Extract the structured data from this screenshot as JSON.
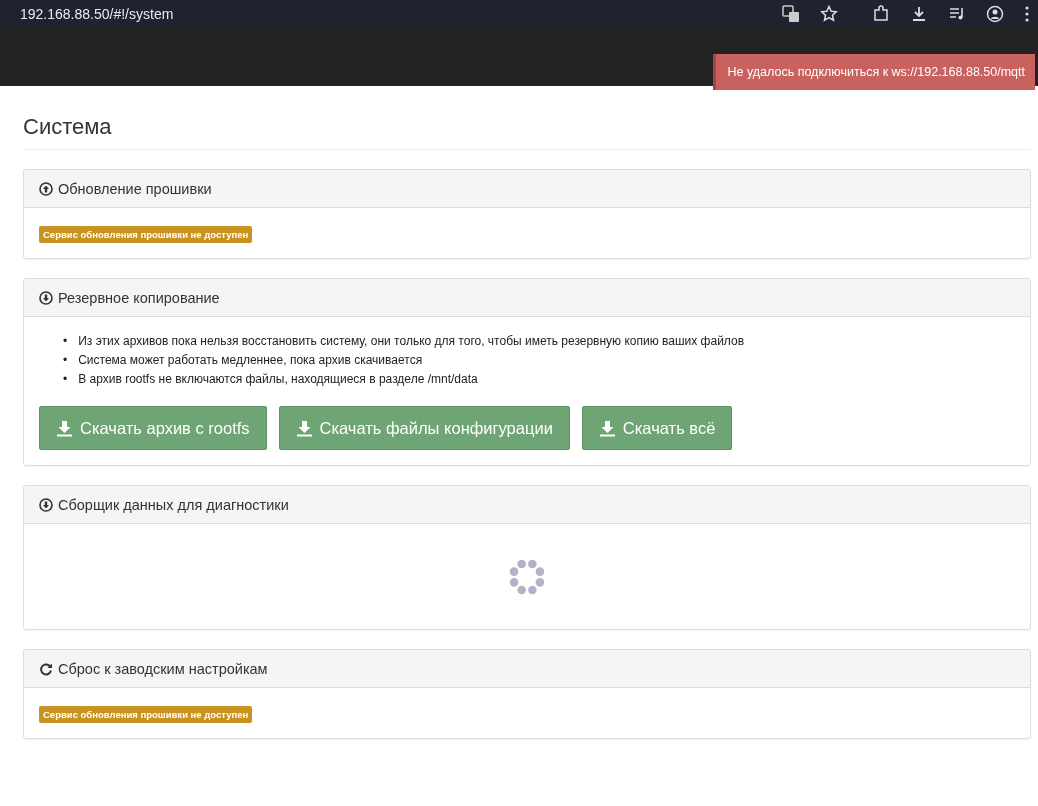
{
  "browser": {
    "address": "192.168.88.50/#!/system"
  },
  "toast": {
    "message": "Не удалось подключиться к ws://192.168.88.50/mqtt"
  },
  "page": {
    "title": "Система"
  },
  "panels": [
    {
      "kind": "badge",
      "title": "Обновление прошивки",
      "badge": "Сервис обновления прошивки не доступен"
    },
    {
      "kind": "list_buttons",
      "title": "Резервное копирование",
      "items": [
        {
          "bullet": "•",
          "text": "Из этих архивов пока нельзя восстановить систему, они только для того, чтобы иметь резервную копию ваших файлов"
        },
        {
          "bullet": "•",
          "text": "Система может работать медленнее, пока архив скачивается"
        },
        {
          "bullet": "•",
          "text": "В архив rootfs не включаются файлы, находящиеся в разделе /mnt/data"
        }
      ],
      "buttons": [
        "Скачать архив с rootfs",
        "Скачать файлы конфигурации",
        "Скачать всё"
      ]
    },
    {
      "kind": "loading",
      "title": "Сборщик данных для диагностики"
    },
    {
      "kind": "badge",
      "title": "Сброс к заводским настройкам",
      "badge": "Сервис обновления прошивки не доступен"
    }
  ]
}
